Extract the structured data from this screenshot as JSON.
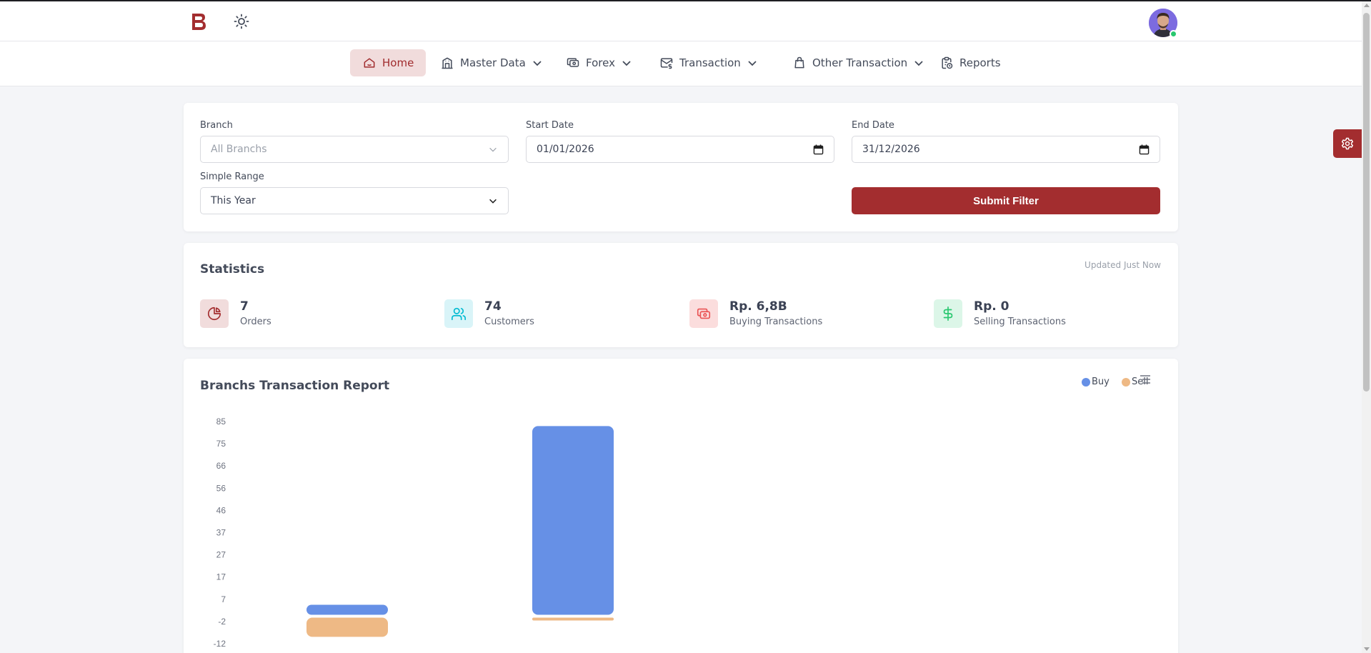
{
  "nav": {
    "items": [
      {
        "label": "Home",
        "icon": "home-icon",
        "has_dropdown": false,
        "active": true
      },
      {
        "label": "Master Data",
        "icon": "building-icon",
        "has_dropdown": true,
        "active": false
      },
      {
        "label": "Forex",
        "icon": "money-icon",
        "has_dropdown": true,
        "active": false
      },
      {
        "label": "Transaction",
        "icon": "mail-money-icon",
        "has_dropdown": true,
        "active": false
      },
      {
        "label": "Other Transaction",
        "icon": "shopping-bag-icon",
        "has_dropdown": true,
        "active": false
      },
      {
        "label": "Reports",
        "icon": "clipboard-icon",
        "has_dropdown": false,
        "active": false
      }
    ]
  },
  "filter": {
    "branch_label": "Branch",
    "branch_placeholder": "All Branchs",
    "start_date_label": "Start Date",
    "start_date_value": "01/01/2026",
    "end_date_label": "End Date",
    "end_date_value": "31/12/2026",
    "range_label": "Simple Range",
    "range_value": "This Year",
    "submit_label": "Submit Filter"
  },
  "statistics": {
    "title": "Statistics",
    "updated": "Updated Just Now",
    "items": [
      {
        "value": "7",
        "label": "Orders",
        "icon": "pie-chart-icon",
        "color": "#a32d2f",
        "bg": "#f1dcdc"
      },
      {
        "value": "74",
        "label": "Customers",
        "icon": "users-icon",
        "color": "#00bad1",
        "bg": "#d9f4f8"
      },
      {
        "value": "Rp. 6,8B",
        "label": "Buying Transactions",
        "icon": "money-icon",
        "color": "#ea5455",
        "bg": "#fbdddd"
      },
      {
        "value": "Rp. 0",
        "label": "Selling Transactions",
        "icon": "dollar-icon",
        "color": "#28c76f",
        "bg": "#dcf6e8"
      }
    ]
  },
  "report": {
    "title": "Branchs Transaction Report",
    "legend": [
      {
        "name": "Buy",
        "color": "#6690e6"
      },
      {
        "name": "Sell",
        "color": "#eeb985"
      }
    ]
  },
  "chart_data": {
    "type": "bar",
    "title": "Branchs Transaction Report",
    "y_ticks": [
      "85",
      "75",
      "66",
      "56",
      "46",
      "37",
      "27",
      "17",
      "7",
      "-2",
      "-12"
    ],
    "ylim": [
      -12,
      85
    ],
    "categories": [
      "",
      ""
    ],
    "series": [
      {
        "name": "Buy",
        "color": "#6690e6",
        "values": [
          5,
          83
        ]
      },
      {
        "name": "Sell",
        "color": "#eeb985",
        "values": [
          -9,
          -1
        ]
      }
    ],
    "legend_position": "top-right",
    "grid": false
  }
}
